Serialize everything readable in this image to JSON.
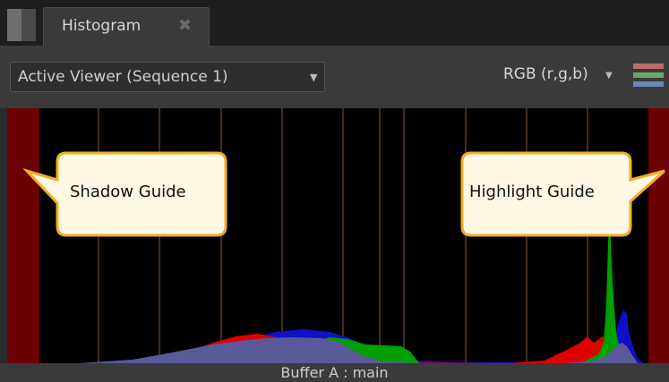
{
  "tab": {
    "title": "Histogram",
    "close_glyph": "✖"
  },
  "toolbar": {
    "viewer_select": "Active Viewer (Sequence 1)",
    "channels_select": "RGB (r,g,b)",
    "channel_swatch_colors": [
      "#c06a6a",
      "#6aa86a",
      "#6a8ab8"
    ]
  },
  "histogram": {
    "colors": {
      "background": "#000000",
      "shadow_guide": "#6b0000",
      "highlight_guide": "#6b0000",
      "gridline": "#8a5a30",
      "red": "#e00000",
      "green": "#00a000",
      "blue": "#1010c8",
      "composite": "#5a5a9a"
    },
    "annotations": [
      {
        "id": "shadow",
        "label": "Shadow Guide"
      },
      {
        "id": "highlight",
        "label": "Highlight Guide"
      }
    ],
    "bubble_colors": {
      "fill": "#fff8e4",
      "stroke": "#f0b020"
    }
  },
  "status": {
    "text": "Buffer A : main"
  }
}
